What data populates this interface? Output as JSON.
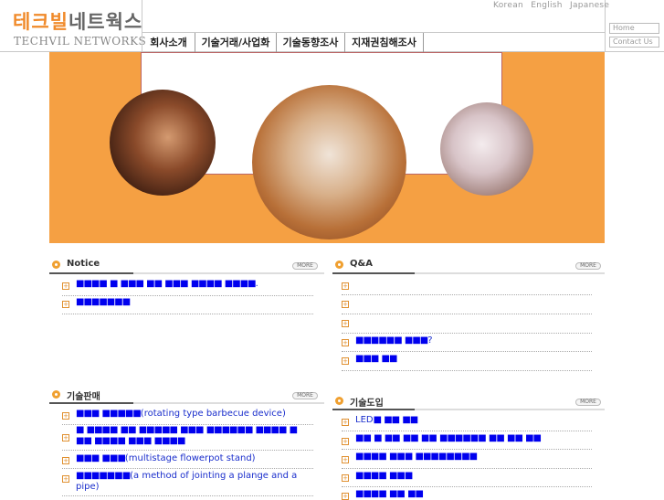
{
  "header": {
    "logo_korean_a": "테크빌",
    "logo_korean_b": "네트웍스",
    "logo_english": "TECHVIL NETWORKS",
    "languages": [
      "Korean",
      "English",
      "Japanese"
    ],
    "home_label": "Home",
    "contact_label": "Contact Us"
  },
  "nav": {
    "items": [
      "회사소개",
      "기술거래/사업화",
      "기술동향조사",
      "지재권침해조사"
    ]
  },
  "sections": {
    "notice": {
      "title": "Notice",
      "more": "MORE",
      "items": [
        "■■■■ ■ ■■■ ■■ ■■■ ■■■■ ■■■■.",
        "■■■■■■■"
      ]
    },
    "qa": {
      "title": "Q&A",
      "more": "MORE",
      "items": [
        "",
        "",
        "",
        "■■■■■■ ■■■?",
        "■■■ ■■"
      ]
    },
    "tech_sale": {
      "title": "기술판매",
      "more": "MORE",
      "items": [
        "■■■ ■■■■■(rotating type barbecue device)",
        "■ ■■■■ ■■ ■■■■■ ■■■ ■■■■■■ ■■■■ ■",
        "■■ ■■■■ ■■■ ■■■■",
        "■■■ ■■■(multistage flowerpot stand)",
        "■■■■■■■(a method of jointing a plange and a",
        "pipe)"
      ]
    },
    "tech_intro": {
      "title": "기술도입",
      "more": "MORE",
      "items": [
        "LED■ ■■ ■■",
        "■■ ■ ■■ ■■ ■■ ■■■■■■ ■■ ■■ ■■",
        "■■■■ ■■■ ■■■■■■■■",
        "■■■■ ■■■",
        "■■■■ ■■ ■■"
      ]
    }
  },
  "colors": {
    "accent": "#f5a043",
    "link": "#1a2ecc"
  }
}
